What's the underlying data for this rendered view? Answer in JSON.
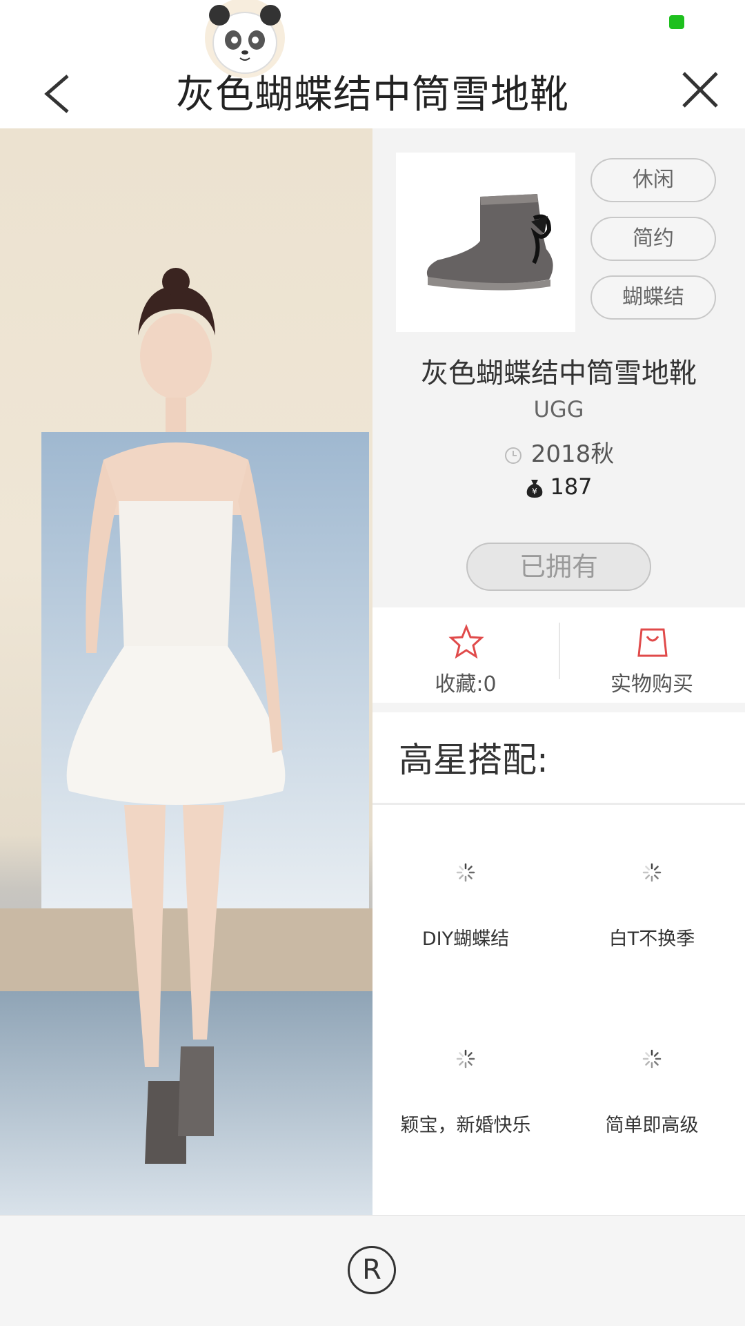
{
  "header": {
    "title": "灰色蝴蝶结中筒雪地靴"
  },
  "product": {
    "tags": [
      "休闲",
      "简约",
      "蝴蝶结"
    ],
    "name": "灰色蝴蝶结中筒雪地靴",
    "brand": "UGG",
    "season": "2018秋",
    "price": "187",
    "owned_label": "已拥有"
  },
  "actions": {
    "favorite_label": "收藏:0",
    "buy_label": "实物购买"
  },
  "colors": {
    "accent": "#e04a4a",
    "status_green": "#1ec01e"
  },
  "outfits": {
    "title": "高星搭配:",
    "items": [
      {
        "label": "DIY蝴蝶结"
      },
      {
        "label": "白T不换季"
      },
      {
        "label": "颖宝，新婚快乐"
      },
      {
        "label": "简单即高级"
      }
    ]
  },
  "bottom": {
    "r_label": "R"
  }
}
